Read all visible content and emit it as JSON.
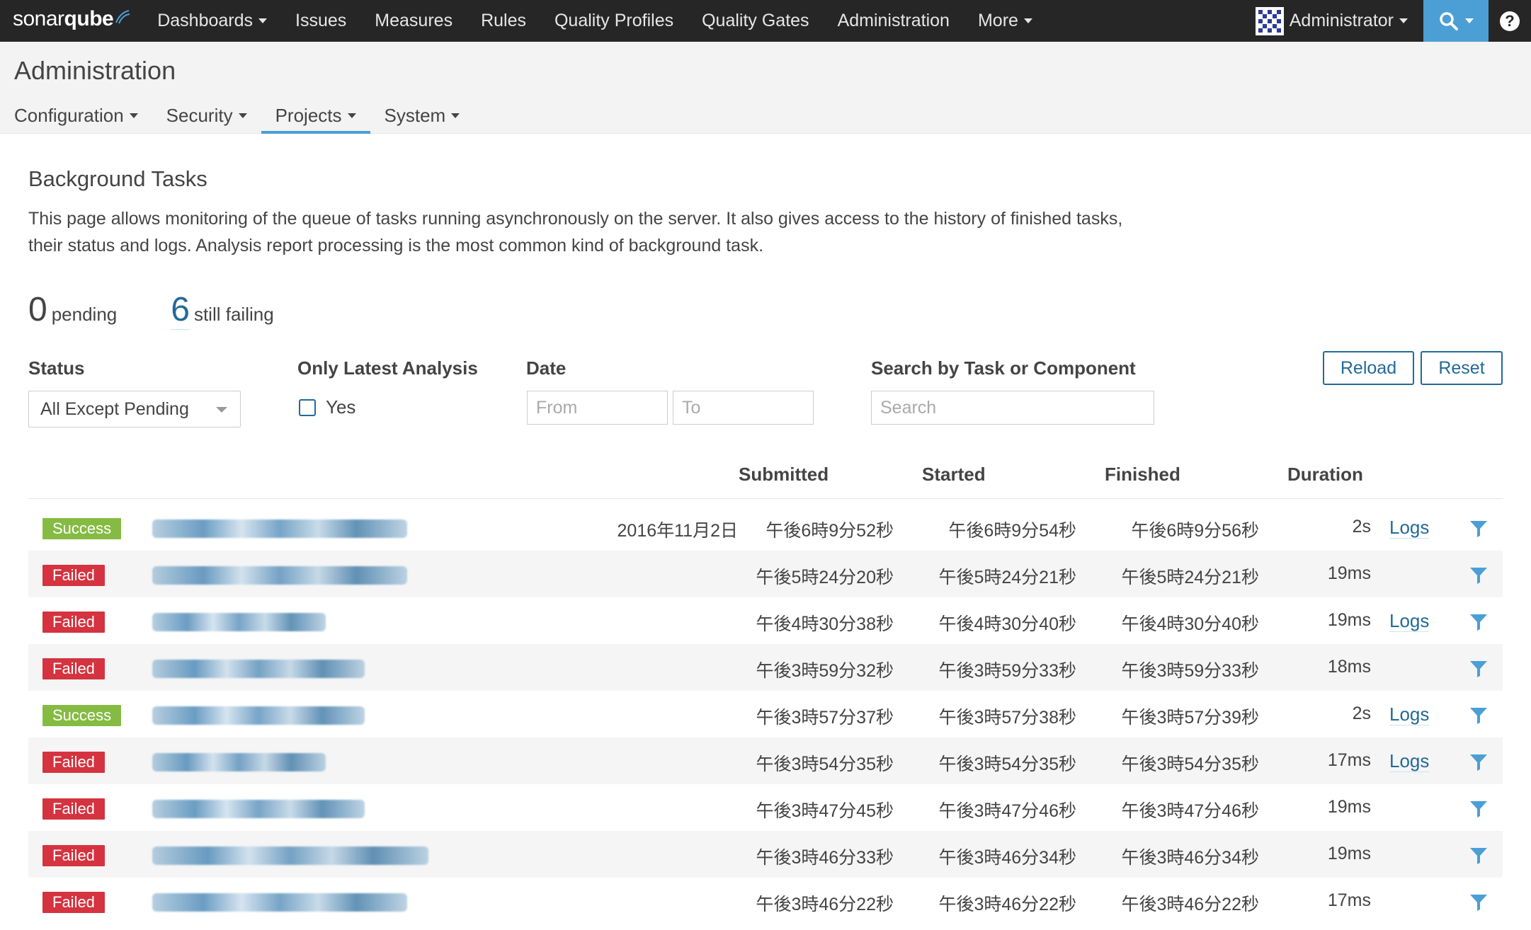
{
  "navbar": {
    "logo_text_a": "sonar",
    "logo_text_b": "qube",
    "items": [
      "Dashboards",
      "Issues",
      "Measures",
      "Rules",
      "Quality Profiles",
      "Quality Gates",
      "Administration",
      "More"
    ],
    "user": "Administrator",
    "help": "?"
  },
  "context": {
    "title": "Administration",
    "tabs": [
      "Configuration",
      "Security",
      "Projects",
      "System"
    ],
    "active_tab": "Projects"
  },
  "page": {
    "title": "Background Tasks",
    "description": "This page allows monitoring of the queue of tasks running asynchronously on the server. It also gives access to the history of finished tasks, their status and logs. Analysis report processing is the most common kind of background task.",
    "stats": {
      "pending_count": "0",
      "pending_label": "pending",
      "failing_count": "6",
      "failing_label": "still failing"
    }
  },
  "filters": {
    "status_label": "Status",
    "status_value": "All Except Pending",
    "latest_label": "Only Latest Analysis",
    "latest_option": "Yes",
    "date_label": "Date",
    "from_placeholder": "From",
    "to_placeholder": "To",
    "search_label": "Search by Task or Component",
    "search_placeholder": "Search",
    "reload_label": "Reload",
    "reset_label": "Reset"
  },
  "table": {
    "headers": {
      "submitted": "Submitted",
      "started": "Started",
      "finished": "Finished",
      "duration": "Duration"
    },
    "rows": [
      {
        "status": "Success",
        "date": "2016年11月2日",
        "submitted": "午後6時9分52秒",
        "started": "午後6時9分54秒",
        "finished": "午後6時9分56秒",
        "duration": "2s",
        "logs": "Logs"
      },
      {
        "status": "Failed",
        "date": "",
        "submitted": "午後5時24分20秒",
        "started": "午後5時24分21秒",
        "finished": "午後5時24分21秒",
        "duration": "19ms",
        "logs": ""
      },
      {
        "status": "Failed",
        "date": "",
        "submitted": "午後4時30分38秒",
        "started": "午後4時30分40秒",
        "finished": "午後4時30分40秒",
        "duration": "19ms",
        "logs": "Logs"
      },
      {
        "status": "Failed",
        "date": "",
        "submitted": "午後3時59分32秒",
        "started": "午後3時59分33秒",
        "finished": "午後3時59分33秒",
        "duration": "18ms",
        "logs": ""
      },
      {
        "status": "Success",
        "date": "",
        "submitted": "午後3時57分37秒",
        "started": "午後3時57分38秒",
        "finished": "午後3時57分39秒",
        "duration": "2s",
        "logs": "Logs"
      },
      {
        "status": "Failed",
        "date": "",
        "submitted": "午後3時54分35秒",
        "started": "午後3時54分35秒",
        "finished": "午後3時54分35秒",
        "duration": "17ms",
        "logs": "Logs"
      },
      {
        "status": "Failed",
        "date": "",
        "submitted": "午後3時47分45秒",
        "started": "午後3時47分46秒",
        "finished": "午後3時47分46秒",
        "duration": "19ms",
        "logs": ""
      },
      {
        "status": "Failed",
        "date": "",
        "submitted": "午後3時46分33秒",
        "started": "午後3時46分34秒",
        "finished": "午後3時46分34秒",
        "duration": "19ms",
        "logs": ""
      },
      {
        "status": "Failed",
        "date": "",
        "submitted": "午後3時46分22秒",
        "started": "午後3時46分22秒",
        "finished": "午後3時46分22秒",
        "duration": "17ms",
        "logs": ""
      }
    ]
  },
  "colors": {
    "navbar_bg": "#262626",
    "accent": "#4b9fd5",
    "link": "#236a97",
    "success": "#85bb43",
    "failed": "#d4333f"
  },
  "icons": {
    "search": "search-icon",
    "help": "help-icon",
    "filter": "filter-icon"
  }
}
